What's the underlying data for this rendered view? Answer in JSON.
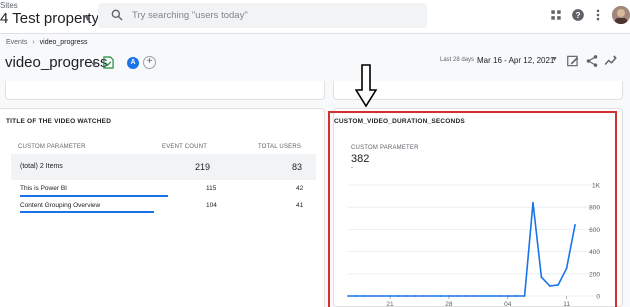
{
  "header": {
    "sites_label": "Sites",
    "property_name": "4 Test property",
    "search_placeholder": "Try searching \"users today\"",
    "icons": [
      "apps-grid-icon",
      "help-icon",
      "more-vert-icon",
      "avatar"
    ]
  },
  "breadcrumb": {
    "items": [
      "Events",
      "video_progress"
    ]
  },
  "page": {
    "title": "video_progress",
    "badge_letter": "A",
    "date_label": "Last 28 days",
    "date_range": "Mar 16 - Apr 12, 2021"
  },
  "left_card": {
    "heading": "TITLE OF THE VIDEO WATCHED",
    "columns": [
      "CUSTOM PARAMETER",
      "EVENT COUNT",
      "TOTAL USERS"
    ],
    "total": {
      "label": "(total) 2 Items",
      "event_count": "219",
      "total_users": "83"
    },
    "rows": [
      {
        "label": "This is Power BI",
        "event_count": "115",
        "total_users": "42",
        "share": 0.525
      },
      {
        "label": "Content Grouping Overview",
        "event_count": "104",
        "total_users": "41",
        "share": 0.475
      }
    ]
  },
  "right_card": {
    "heading": "CUSTOM_VIDEO_DURATION_SECONDS",
    "metric_label": "CUSTOM PARAMETER",
    "metric_value": "382",
    "metric_sub": "-"
  },
  "chart_data": {
    "type": "line",
    "x": [
      "Mar 16",
      "Mar 17",
      "Mar 18",
      "Mar 19",
      "Mar 20",
      "Mar 21",
      "Mar 22",
      "Mar 23",
      "Mar 24",
      "Mar 25",
      "Mar 26",
      "Mar 27",
      "Mar 28",
      "Mar 29",
      "Mar 30",
      "Mar 31",
      "Apr 01",
      "Apr 02",
      "Apr 03",
      "Apr 04",
      "Apr 05",
      "Apr 06",
      "Apr 07",
      "Apr 08",
      "Apr 09",
      "Apr 10",
      "Apr 11",
      "Apr 12"
    ],
    "series": [
      {
        "values": [
          0,
          0,
          0,
          0,
          0,
          0,
          0,
          0,
          0,
          0,
          0,
          0,
          0,
          0,
          0,
          0,
          0,
          0,
          0,
          0,
          0,
          0,
          840,
          170,
          90,
          100,
          250,
          640
        ]
      }
    ],
    "ylim": [
      0,
      1000
    ],
    "y_ticks": [
      "0",
      "200",
      "400",
      "600",
      "800",
      "1K"
    ],
    "x_ticks": [
      "21",
      "28",
      "04",
      "11"
    ],
    "x_tick_indices": [
      5,
      12,
      19,
      26
    ],
    "line_color": "#1a73e8",
    "grid": true
  }
}
